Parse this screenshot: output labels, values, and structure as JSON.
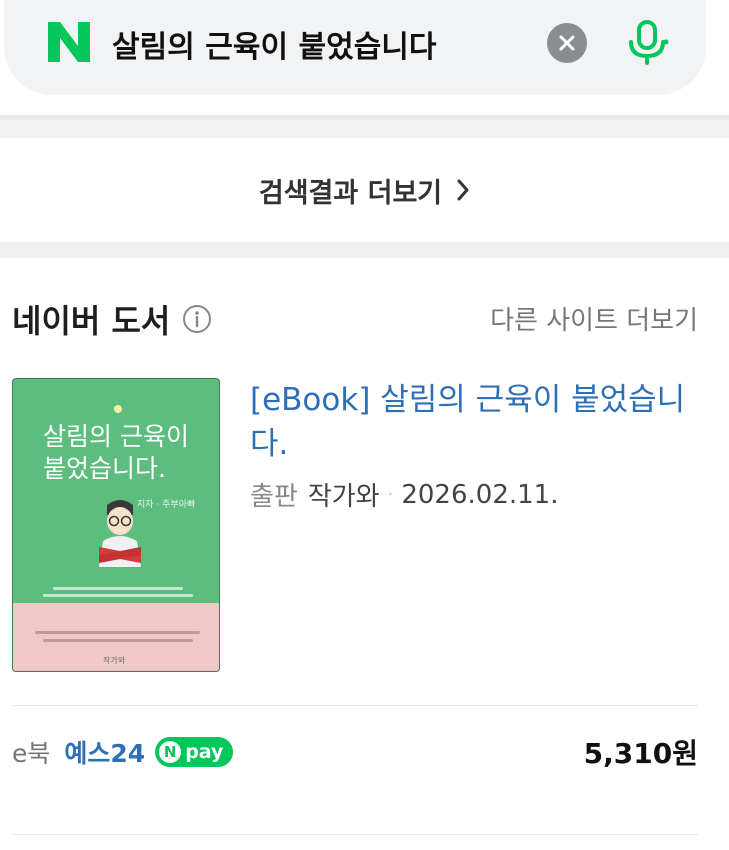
{
  "search": {
    "query": "살림의 근육이 붙었습니다",
    "logo_letter": "N",
    "brand_color": "#03c75a",
    "clear_icon": "close-icon",
    "mic_icon": "microphone-icon"
  },
  "more_results": {
    "label": "검색결과 더보기",
    "chevron": "›"
  },
  "section": {
    "title": "네이버 도서",
    "info_icon": "info-icon",
    "other_sites_link": "다른 사이트 더보기"
  },
  "book": {
    "cover": {
      "title_line1": "살림의 근육이",
      "title_line2": "붙었습니다.",
      "author": "지자 · 주부아빠",
      "publisher": "작가와"
    },
    "title": "[eBook] 살림의 근육이 붙었습니다.",
    "publisher_label": "출판",
    "publisher": "작가와",
    "separator": "·",
    "date": "2026.02.11."
  },
  "offer": {
    "format_label": "e북",
    "store": "예스24",
    "npay_letter": "N",
    "npay_label": "pay",
    "price": "5,310원"
  }
}
